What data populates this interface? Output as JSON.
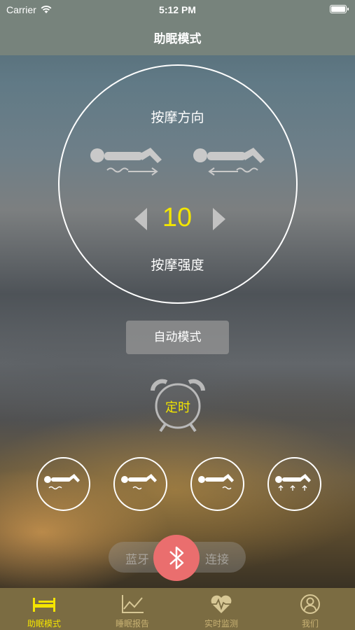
{
  "status_bar": {
    "carrier": "Carrier",
    "time": "5:12 PM"
  },
  "nav": {
    "title": "助眠模式"
  },
  "massage": {
    "direction_title": "按摩方向",
    "level": "10",
    "strength_title": "按摩强度"
  },
  "auto_mode": {
    "label": "自动模式"
  },
  "timer": {
    "label": "定时"
  },
  "bluetooth": {
    "left_text": "蓝牙",
    "right_text": "连接"
  },
  "tab_bar": {
    "tabs": [
      {
        "label": "助眠模式",
        "icon": "bed-icon",
        "active": true
      },
      {
        "label": "睡眠报告",
        "icon": "chart-icon",
        "active": false
      },
      {
        "label": "实时监测",
        "icon": "heart-monitor-icon",
        "active": false
      },
      {
        "label": "我们",
        "icon": "user-icon",
        "active": false
      }
    ]
  },
  "colors": {
    "accent_yellow": "#f2e500",
    "bluetooth_red": "#ea6e6e",
    "tab_bar": "#7b6c42",
    "nav_bar": "#77837c"
  }
}
